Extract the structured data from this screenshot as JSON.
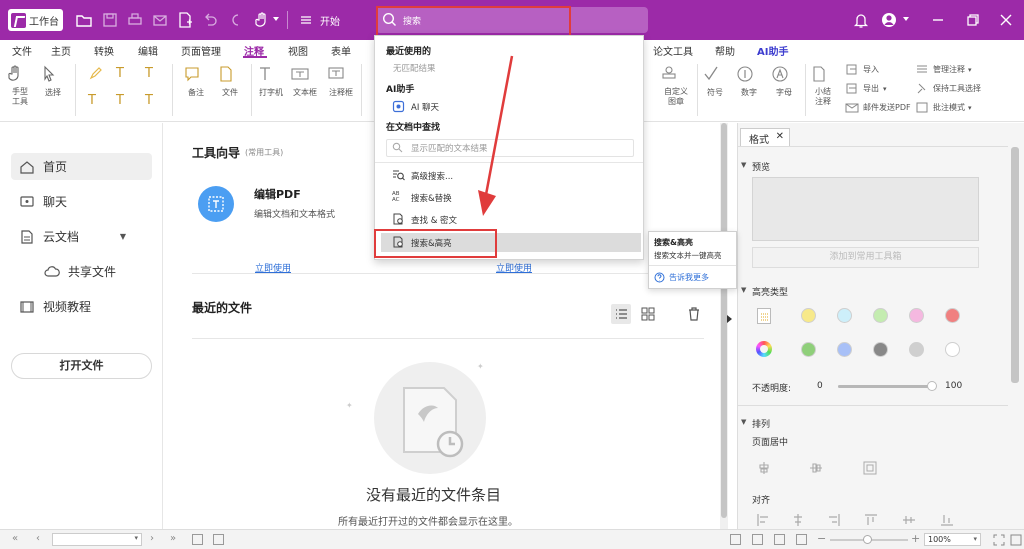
{
  "topbar": {
    "workbench_label": "工作台",
    "start_label": "开始",
    "search_placeholder": "搜索"
  },
  "menu": [
    "文件",
    "主页",
    "转换",
    "编辑",
    "页面管理",
    "注释",
    "视图",
    "表单",
    "论文工具",
    "帮助",
    "AI助手"
  ],
  "menu_active": "注释",
  "ribbon": {
    "hand_tool": "手型\n工具",
    "select": "选择",
    "note": "备注",
    "file": "文件",
    "typewriter": "打字机",
    "textbox": "文本框",
    "annot_box": "注释框",
    "custom_stamp": "自定义\n图章",
    "symbol": "符号",
    "number": "数字",
    "letter": "字母",
    "summary": "小结\n注释",
    "import": "导入",
    "export": "导出",
    "email": "邮件发送PDF",
    "manage": "管理注释",
    "keep_tool": "保持工具选择",
    "batch_mode": "批注模式"
  },
  "sidebar": {
    "items": [
      {
        "label": "首页",
        "icon": "home-icon",
        "active": true
      },
      {
        "label": "聊天",
        "icon": "chat-icon",
        "active": false
      },
      {
        "label": "云文档",
        "icon": "cloud-doc-icon",
        "active": false
      },
      {
        "label": "共享文件",
        "icon": "cloud-share-icon",
        "active": false
      },
      {
        "label": "视频教程",
        "icon": "video-icon",
        "active": false
      }
    ],
    "open_file": "打开文件"
  },
  "main": {
    "tools_title": "工具向导",
    "tools_subtitle": "(常用工具)",
    "tool_name": "编辑PDF",
    "tool_desc": "编辑文档和文本格式",
    "use_now": "立即使用",
    "use_now_2": "立即使用",
    "recent_title": "最近的文件",
    "empty_title": "没有最近的文件条目",
    "empty_desc": "所有最近打开过的文件都会显示在这里。"
  },
  "dropdown": {
    "recent_header": "最近使用的",
    "no_match": "无匹配结果",
    "ai_header": "AI助手",
    "ai_chat": "AI 聊天",
    "doc_header": "在文档中查找",
    "doc_placeholder": "显示匹配的文本结果",
    "adv_search": "高级搜索...",
    "search_replace": "搜索&替换",
    "find_redact": "查找 & 密文",
    "search_highlight": "搜索&高亮"
  },
  "tooltip": {
    "title": "搜索&高亮",
    "desc": "搜索文本并一键高亮",
    "tell_more": "告诉我更多"
  },
  "rpanel": {
    "tab": "格式",
    "preview": "预览",
    "add_tools": "添加到常用工具箱",
    "highlight_type": "高亮类型",
    "opacity_label": "不透明度:",
    "opacity_min": "0",
    "opacity_max": "100",
    "arrange": "排列",
    "page_center": "页面居中",
    "align": "对齐"
  },
  "colors": {
    "brand": "#9c2aa8",
    "highlight_rect": "#e03c3c",
    "swatches_row1": [
      "#f7e98a",
      "#cdeffa",
      "#c4ecb0",
      "#f5b8e0",
      "#f08080"
    ],
    "swatches_row2": [
      "#8fcf7a",
      "#a8c0f7",
      "#888888",
      "#cfcfcf",
      "#ffffff"
    ]
  },
  "status": {
    "zoom": "100%",
    "opacity_fraction": 1.0
  }
}
